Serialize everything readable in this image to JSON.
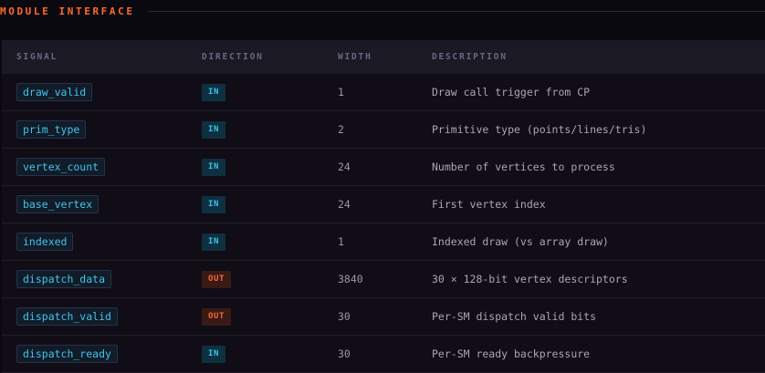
{
  "section": {
    "title": "MODULE INTERFACE"
  },
  "table": {
    "headers": [
      "SIGNAL",
      "DIRECTION",
      "WIDTH",
      "DESCRIPTION"
    ],
    "rows": [
      {
        "signal": "draw_valid",
        "direction": "IN",
        "width": "1",
        "description": "Draw call trigger from CP"
      },
      {
        "signal": "prim_type",
        "direction": "IN",
        "width": "2",
        "description": "Primitive type (points/lines/tris)"
      },
      {
        "signal": "vertex_count",
        "direction": "IN",
        "width": "24",
        "description": "Number of vertices to process"
      },
      {
        "signal": "base_vertex",
        "direction": "IN",
        "width": "24",
        "description": "First vertex index"
      },
      {
        "signal": "indexed",
        "direction": "IN",
        "width": "1",
        "description": "Indexed draw (vs array draw)"
      },
      {
        "signal": "dispatch_data",
        "direction": "OUT",
        "width": "3840",
        "description": "30 × 128-bit vertex descriptors"
      },
      {
        "signal": "dispatch_valid",
        "direction": "OUT",
        "width": "30",
        "description": "Per-SM dispatch valid bits"
      },
      {
        "signal": "dispatch_ready",
        "direction": "IN",
        "width": "30",
        "description": "Per-SM ready backpressure"
      }
    ]
  },
  "colors": {
    "accent": "#ff6a2a",
    "signal_text": "#3fc5ec",
    "in_badge": "#38c6ea",
    "out_badge": "#f26a3a"
  }
}
